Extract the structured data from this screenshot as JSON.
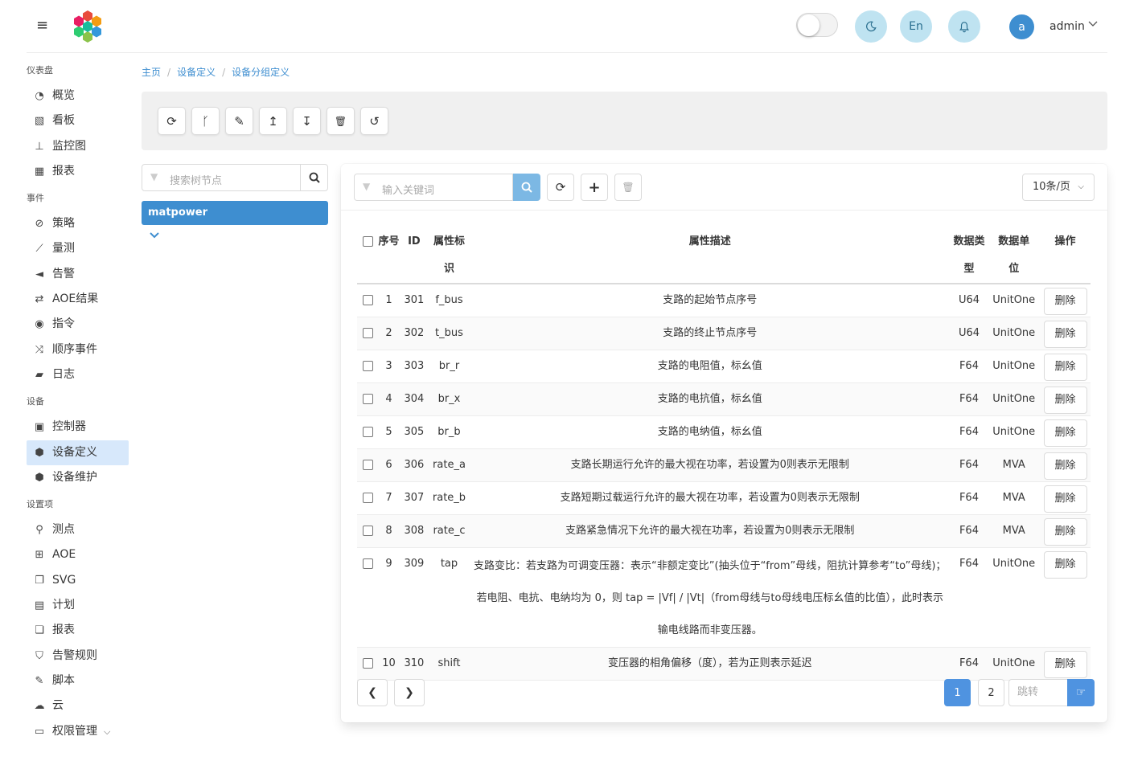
{
  "header": {
    "menu_icon": "hamburger-icon",
    "logo_icon": "hexagon-flower-logo",
    "theme_toggle_state": "off",
    "dark_mode_icon": "moon-icon",
    "language_label": "En",
    "notification_icon": "bell-icon",
    "avatar_letter": "a",
    "username": "admin",
    "caret": "⌵"
  },
  "sidebar": {
    "sections": [
      {
        "label": "仪表盘",
        "items": [
          {
            "icon": "dashboard-icon",
            "glyph": "◔",
            "label": "概览"
          },
          {
            "icon": "kanban-icon",
            "glyph": "▧",
            "label": "看板"
          },
          {
            "icon": "sitemap-icon",
            "glyph": "⊥",
            "label": "监控图"
          },
          {
            "icon": "table-icon",
            "glyph": "▦",
            "label": "报表"
          }
        ]
      },
      {
        "label": "事件",
        "items": [
          {
            "icon": "compass-icon",
            "glyph": "⊘",
            "label": "策略"
          },
          {
            "icon": "line-chart-icon",
            "glyph": "⟋",
            "label": "量测"
          },
          {
            "icon": "bullhorn-icon",
            "glyph": "◄",
            "label": "告警"
          },
          {
            "icon": "exchange-icon",
            "glyph": "⇄",
            "label": "AOE结果"
          },
          {
            "icon": "podcast-icon",
            "glyph": "◉",
            "label": "指令"
          },
          {
            "icon": "random-icon",
            "glyph": "⤨",
            "label": "顺序事件"
          },
          {
            "icon": "book-icon",
            "glyph": "▰",
            "label": "日志"
          }
        ]
      },
      {
        "label": "设备",
        "items": [
          {
            "icon": "controller-icon",
            "glyph": "▣",
            "label": "控制器"
          },
          {
            "icon": "cube-icon",
            "glyph": "⬢",
            "label": "设备定义",
            "active": true
          },
          {
            "icon": "cubes-icon",
            "glyph": "⬢",
            "label": "设备维护"
          }
        ]
      },
      {
        "label": "设置项",
        "items": [
          {
            "icon": "map-pin-icon",
            "glyph": "⚲",
            "label": "测点"
          },
          {
            "icon": "project-diagram-icon",
            "glyph": "⊞",
            "label": "AOE"
          },
          {
            "icon": "clone-icon",
            "glyph": "❐",
            "label": "SVG"
          },
          {
            "icon": "calendar-check-icon",
            "glyph": "▤",
            "label": "计划"
          },
          {
            "icon": "copy-icon",
            "glyph": "❏",
            "label": "报表"
          },
          {
            "icon": "shield-icon",
            "glyph": "⛉",
            "label": "告警规则"
          },
          {
            "icon": "magic-icon",
            "glyph": "✎",
            "label": "脚本"
          },
          {
            "icon": "cloud-icon",
            "glyph": "☁",
            "label": "云"
          },
          {
            "icon": "id-card-icon",
            "glyph": "▭",
            "label": "权限管理",
            "has_submenu": true
          }
        ]
      }
    ]
  },
  "breadcrumb": [
    "主页",
    "设备定义",
    "设备分组定义"
  ],
  "toolbar": {
    "buttons": [
      {
        "name": "refresh-button",
        "icon": "sync-icon",
        "glyph": "⟳"
      },
      {
        "name": "branch-button",
        "icon": "code-branch-icon",
        "glyph": "ᚴ"
      },
      {
        "name": "edit-button",
        "icon": "pencil-icon",
        "glyph": "✎"
      },
      {
        "name": "import-button",
        "icon": "level-up-icon",
        "glyph": "↥"
      },
      {
        "name": "export-button",
        "icon": "level-down-icon",
        "glyph": "↧"
      },
      {
        "name": "delete-button",
        "icon": "trash-icon",
        "glyph": "🗑"
      },
      {
        "name": "undo-button",
        "icon": "undo-icon",
        "glyph": "↺"
      }
    ]
  },
  "tree": {
    "search_placeholder": "搜索树节点",
    "filter_icon": "filter-icon",
    "search_icon": "search-icon",
    "root_node": "matpower",
    "expand_icon": "chevron-down-icon"
  },
  "table_panel": {
    "keyword_placeholder": "输入关键词",
    "page_size": "10条/页",
    "columns": [
      "序号",
      "ID",
      "属性标识",
      "属性描述",
      "数据类型",
      "数据单位",
      "操作"
    ],
    "delete_label": "删除",
    "rows": [
      {
        "no": "1",
        "id": "301",
        "key": "f_bus",
        "desc": "支路的起始节点序号",
        "type": "U64",
        "unit": "UnitOne"
      },
      {
        "no": "2",
        "id": "302",
        "key": "t_bus",
        "desc": "支路的终止节点序号",
        "type": "U64",
        "unit": "UnitOne"
      },
      {
        "no": "3",
        "id": "303",
        "key": "br_r",
        "desc": "支路的电阻值，标幺值",
        "type": "F64",
        "unit": "UnitOne"
      },
      {
        "no": "4",
        "id": "304",
        "key": "br_x",
        "desc": "支路的电抗值，标幺值",
        "type": "F64",
        "unit": "UnitOne"
      },
      {
        "no": "5",
        "id": "305",
        "key": "br_b",
        "desc": "支路的电纳值，标幺值",
        "type": "F64",
        "unit": "UnitOne"
      },
      {
        "no": "6",
        "id": "306",
        "key": "rate_a",
        "desc": "支路长期运行允许的最大视在功率，若设置为0则表示无限制",
        "type": "F64",
        "unit": "MVA"
      },
      {
        "no": "7",
        "id": "307",
        "key": "rate_b",
        "desc": "支路短期过载运行允许的最大视在功率，若设置为0则表示无限制",
        "type": "F64",
        "unit": "MVA"
      },
      {
        "no": "8",
        "id": "308",
        "key": "rate_c",
        "desc": "支路紧急情况下允许的最大视在功率，若设置为0则表示无限制",
        "type": "F64",
        "unit": "MVA"
      },
      {
        "no": "9",
        "id": "309",
        "key": "tap",
        "desc": "支路变比：若支路为可调变压器：表示“非额定变比”(抽头位于“from”母线，阻抗计算参考“to”母线)；若电阻、电抗、电纳均为 0，则 tap = |Vf| / |Vt|（from母线与to母线电压标幺值的比值），此时表示输电线路而非变压器。",
        "type": "F64",
        "unit": "UnitOne"
      },
      {
        "no": "10",
        "id": "310",
        "key": "shift",
        "desc": "变压器的相角偏移（度），若为正则表示延迟",
        "type": "F64",
        "unit": "UnitOne"
      }
    ]
  },
  "pagination": {
    "pages": [
      "1",
      "2"
    ],
    "current": "1",
    "jump_placeholder": "跳转"
  }
}
